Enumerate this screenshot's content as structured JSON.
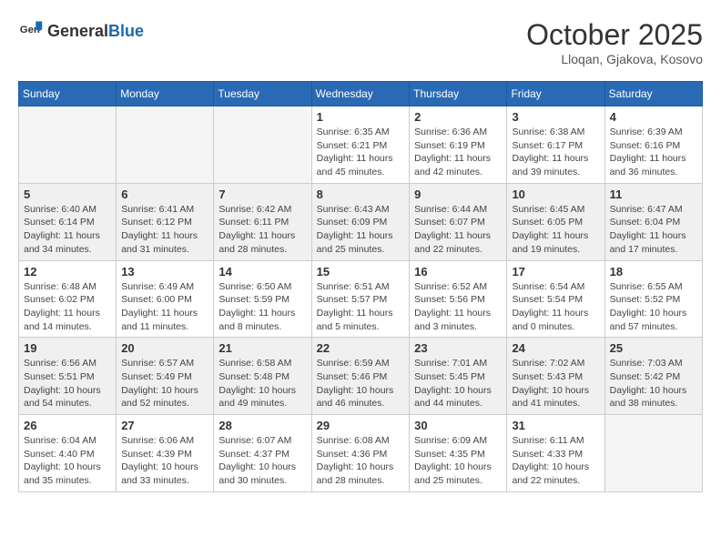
{
  "header": {
    "logo_general": "General",
    "logo_blue": "Blue",
    "month": "October 2025",
    "location": "Lloqan, Gjakova, Kosovo"
  },
  "weekdays": [
    "Sunday",
    "Monday",
    "Tuesday",
    "Wednesday",
    "Thursday",
    "Friday",
    "Saturday"
  ],
  "weeks": [
    [
      {
        "day": "",
        "info": ""
      },
      {
        "day": "",
        "info": ""
      },
      {
        "day": "",
        "info": ""
      },
      {
        "day": "1",
        "info": "Sunrise: 6:35 AM\nSunset: 6:21 PM\nDaylight: 11 hours\nand 45 minutes."
      },
      {
        "day": "2",
        "info": "Sunrise: 6:36 AM\nSunset: 6:19 PM\nDaylight: 11 hours\nand 42 minutes."
      },
      {
        "day": "3",
        "info": "Sunrise: 6:38 AM\nSunset: 6:17 PM\nDaylight: 11 hours\nand 39 minutes."
      },
      {
        "day": "4",
        "info": "Sunrise: 6:39 AM\nSunset: 6:16 PM\nDaylight: 11 hours\nand 36 minutes."
      }
    ],
    [
      {
        "day": "5",
        "info": "Sunrise: 6:40 AM\nSunset: 6:14 PM\nDaylight: 11 hours\nand 34 minutes."
      },
      {
        "day": "6",
        "info": "Sunrise: 6:41 AM\nSunset: 6:12 PM\nDaylight: 11 hours\nand 31 minutes."
      },
      {
        "day": "7",
        "info": "Sunrise: 6:42 AM\nSunset: 6:11 PM\nDaylight: 11 hours\nand 28 minutes."
      },
      {
        "day": "8",
        "info": "Sunrise: 6:43 AM\nSunset: 6:09 PM\nDaylight: 11 hours\nand 25 minutes."
      },
      {
        "day": "9",
        "info": "Sunrise: 6:44 AM\nSunset: 6:07 PM\nDaylight: 11 hours\nand 22 minutes."
      },
      {
        "day": "10",
        "info": "Sunrise: 6:45 AM\nSunset: 6:05 PM\nDaylight: 11 hours\nand 19 minutes."
      },
      {
        "day": "11",
        "info": "Sunrise: 6:47 AM\nSunset: 6:04 PM\nDaylight: 11 hours\nand 17 minutes."
      }
    ],
    [
      {
        "day": "12",
        "info": "Sunrise: 6:48 AM\nSunset: 6:02 PM\nDaylight: 11 hours\nand 14 minutes."
      },
      {
        "day": "13",
        "info": "Sunrise: 6:49 AM\nSunset: 6:00 PM\nDaylight: 11 hours\nand 11 minutes."
      },
      {
        "day": "14",
        "info": "Sunrise: 6:50 AM\nSunset: 5:59 PM\nDaylight: 11 hours\nand 8 minutes."
      },
      {
        "day": "15",
        "info": "Sunrise: 6:51 AM\nSunset: 5:57 PM\nDaylight: 11 hours\nand 5 minutes."
      },
      {
        "day": "16",
        "info": "Sunrise: 6:52 AM\nSunset: 5:56 PM\nDaylight: 11 hours\nand 3 minutes."
      },
      {
        "day": "17",
        "info": "Sunrise: 6:54 AM\nSunset: 5:54 PM\nDaylight: 11 hours\nand 0 minutes."
      },
      {
        "day": "18",
        "info": "Sunrise: 6:55 AM\nSunset: 5:52 PM\nDaylight: 10 hours\nand 57 minutes."
      }
    ],
    [
      {
        "day": "19",
        "info": "Sunrise: 6:56 AM\nSunset: 5:51 PM\nDaylight: 10 hours\nand 54 minutes."
      },
      {
        "day": "20",
        "info": "Sunrise: 6:57 AM\nSunset: 5:49 PM\nDaylight: 10 hours\nand 52 minutes."
      },
      {
        "day": "21",
        "info": "Sunrise: 6:58 AM\nSunset: 5:48 PM\nDaylight: 10 hours\nand 49 minutes."
      },
      {
        "day": "22",
        "info": "Sunrise: 6:59 AM\nSunset: 5:46 PM\nDaylight: 10 hours\nand 46 minutes."
      },
      {
        "day": "23",
        "info": "Sunrise: 7:01 AM\nSunset: 5:45 PM\nDaylight: 10 hours\nand 44 minutes."
      },
      {
        "day": "24",
        "info": "Sunrise: 7:02 AM\nSunset: 5:43 PM\nDaylight: 10 hours\nand 41 minutes."
      },
      {
        "day": "25",
        "info": "Sunrise: 7:03 AM\nSunset: 5:42 PM\nDaylight: 10 hours\nand 38 minutes."
      }
    ],
    [
      {
        "day": "26",
        "info": "Sunrise: 6:04 AM\nSunset: 4:40 PM\nDaylight: 10 hours\nand 35 minutes."
      },
      {
        "day": "27",
        "info": "Sunrise: 6:06 AM\nSunset: 4:39 PM\nDaylight: 10 hours\nand 33 minutes."
      },
      {
        "day": "28",
        "info": "Sunrise: 6:07 AM\nSunset: 4:37 PM\nDaylight: 10 hours\nand 30 minutes."
      },
      {
        "day": "29",
        "info": "Sunrise: 6:08 AM\nSunset: 4:36 PM\nDaylight: 10 hours\nand 28 minutes."
      },
      {
        "day": "30",
        "info": "Sunrise: 6:09 AM\nSunset: 4:35 PM\nDaylight: 10 hours\nand 25 minutes."
      },
      {
        "day": "31",
        "info": "Sunrise: 6:11 AM\nSunset: 4:33 PM\nDaylight: 10 hours\nand 22 minutes."
      },
      {
        "day": "",
        "info": ""
      }
    ]
  ]
}
